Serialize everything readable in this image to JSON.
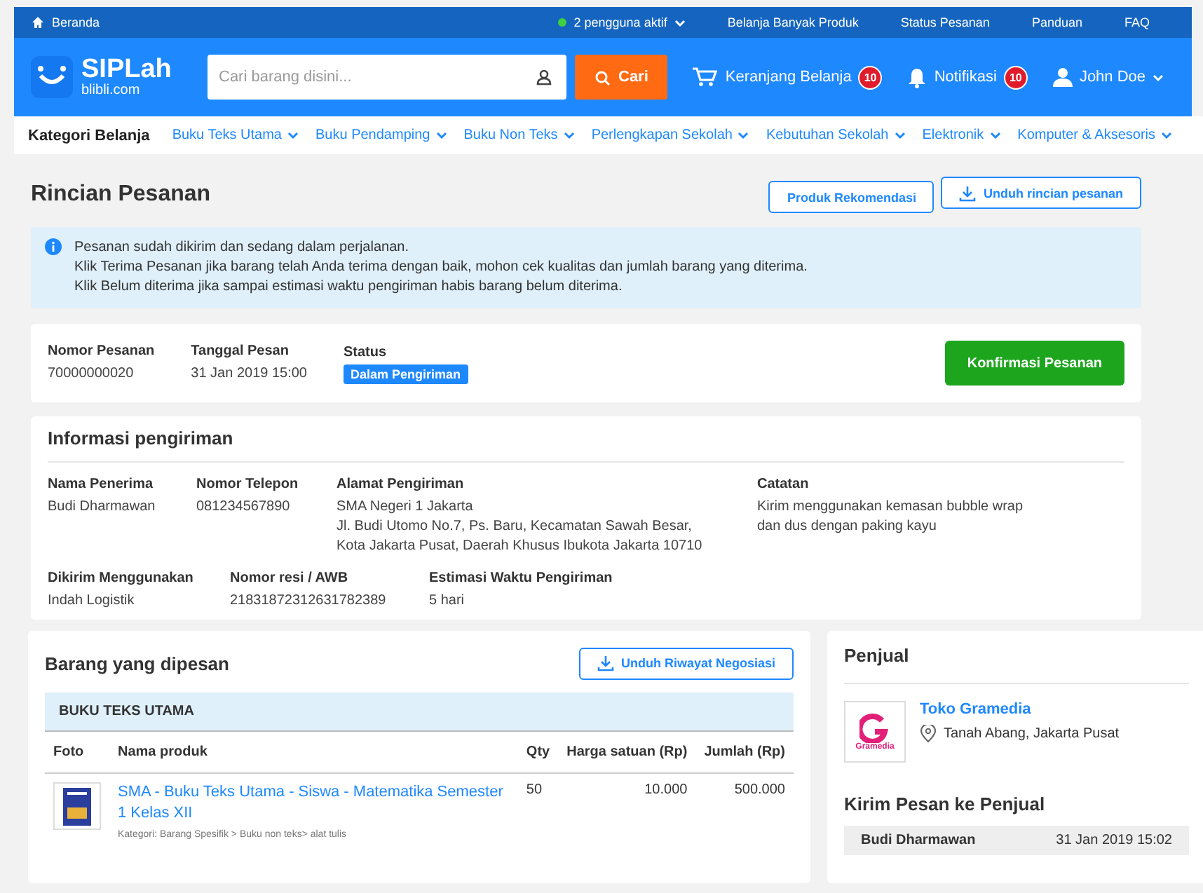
{
  "top_bar": {
    "home": "Beranda",
    "active_users": "2 pengguna aktif",
    "links": [
      "Belanja Banyak Produk",
      "Status Pesanan",
      "Panduan",
      "FAQ"
    ]
  },
  "header": {
    "logo_title": "SIPLah",
    "logo_sub": "blibli.com",
    "search_placeholder": "Cari barang disini...",
    "search_button": "Cari",
    "cart": {
      "label": "Keranjang Belanja",
      "count": "10"
    },
    "notifications": {
      "label": "Notifikasi",
      "count": "10"
    },
    "user": "John Doe"
  },
  "category_nav": {
    "title": "Kategori Belanja",
    "items": [
      "Buku Teks Utama",
      "Buku Pendamping",
      "Buku Non Teks",
      "Perlengkapan Sekolah",
      "Kebutuhan Sekolah",
      "Elektronik",
      "Komputer & Aksesoris"
    ]
  },
  "page": {
    "title": "Rincian Pesanan",
    "buttons": [
      {
        "label": "Produk Rekomendasi",
        "kind": "plain"
      },
      {
        "label": "Unduh rincian pesanan",
        "kind": "download"
      }
    ]
  },
  "alert": {
    "lines": [
      "Pesanan sudah dikirim dan sedang dalam perjalanan.",
      "Klik Terima Pesanan jika barang telah Anda terima dengan baik, mohon cek kualitas dan jumlah barang yang diterima.",
      "Klik Belum diterima jika sampai estimasi waktu pengiriman habis barang belum diterima."
    ]
  },
  "order": {
    "fields": [
      {
        "label": "Nomor Pesanan",
        "value": "70000000020",
        "kind": "text"
      },
      {
        "label": "Tanggal Pesan",
        "value": "31 Jan 2019 15:00",
        "kind": "text"
      },
      {
        "label": "Status",
        "value": "Dalam Pengiriman",
        "kind": "badge"
      }
    ],
    "confirm_button": "Konfirmasi Pesanan"
  },
  "shipping": {
    "title": "Informasi pengiriman",
    "rows": [
      [
        {
          "label": "Nama Penerima",
          "lines": [
            "Budi Dharmawan"
          ]
        },
        {
          "label": "Nomor Telepon",
          "lines": [
            "081234567890"
          ]
        },
        {
          "label": "Alamat Pengiriman",
          "lines": [
            "SMA Negeri 1 Jakarta",
            "Jl. Budi Utomo No.7, Ps. Baru, Kecamatan Sawah Besar,",
            "Kota Jakarta Pusat, Daerah Khusus Ibukota Jakarta 10710"
          ]
        },
        {
          "label": "Catatan",
          "lines": [
            "Kirim  menggunakan kemasan bubble wrap",
            "dan dus dengan paking kayu"
          ]
        }
      ],
      [
        {
          "label": "Dikirim Menggunakan",
          "lines": [
            "Indah Logistik"
          ]
        },
        {
          "label": "Nomor resi / AWB",
          "lines": [
            "21831872312631782389"
          ]
        },
        {
          "label": "Estimasi Waktu Pengiriman",
          "lines": [
            "5 hari"
          ]
        }
      ]
    ]
  },
  "ordered_items": {
    "title": "Barang yang dipesan",
    "download_button": "Unduh Riwayat Negosiasi",
    "group": "BUKU TEKS UTAMA",
    "columns": [
      "Foto",
      "Nama produk",
      "Qty",
      "Harga satuan (Rp)",
      "Jumlah (Rp)"
    ],
    "rows": [
      {
        "name": "SMA - Buku Teks Utama - Siswa - Matematika Semester 1 Kelas XII",
        "category": "Kategori: Barang Spesifik >  Buku non teks> alat tulis",
        "qty": "50",
        "price": "10.000",
        "total": "500.000"
      }
    ]
  },
  "seller": {
    "title": "Penjual",
    "store_name": "Toko Gramedia",
    "store_logo_text": "Gramedia",
    "location": "Tanah Abang, Jakarta Pusat",
    "message_title": "Kirim Pesan ke Penjual",
    "messages": [
      {
        "sender": "Budi Dharmawan",
        "time": "31 Jan 2019 15:02"
      }
    ]
  }
}
